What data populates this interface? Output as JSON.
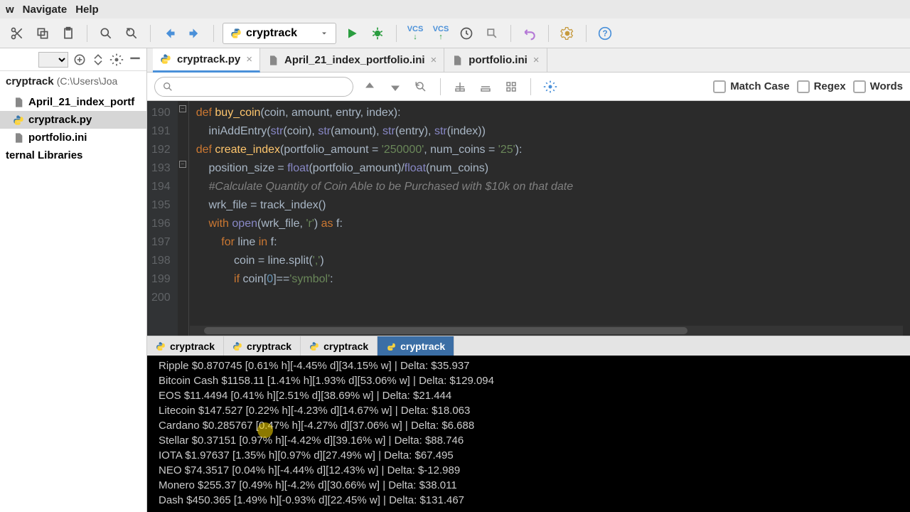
{
  "menu": {
    "items": [
      "w",
      "Navigate",
      "Help"
    ]
  },
  "toolbar": {
    "run_config_label": "cryptrack",
    "vcs_down": "VCS",
    "vcs_up": "VCS"
  },
  "project": {
    "root_name": "cryptrack",
    "root_path": "(C:\\Users\\Joa",
    "files": [
      "April_21_index_portf",
      "cryptrack.py",
      "portfolio.ini"
    ],
    "selected_index": 1,
    "ext_libs_label": "ternal Libraries"
  },
  "tabs": [
    {
      "label": "cryptrack.py",
      "active": true
    },
    {
      "label": "April_21_index_portfolio.ini",
      "active": false
    },
    {
      "label": "portfolio.ini",
      "active": false
    }
  ],
  "findbar": {
    "placeholder": "",
    "match_case": "Match Case",
    "regex": "Regex",
    "words": "Words"
  },
  "editor": {
    "first_line": 190,
    "lines": [
      190,
      191,
      192,
      193,
      194,
      195,
      196,
      197,
      198,
      199,
      200
    ],
    "code_lines": [
      {
        "t": "def",
        "tokens": [
          [
            "kw",
            "def "
          ],
          [
            "fn",
            "buy_coin"
          ],
          [
            "",
            "("
          ],
          [
            "",
            "coin, amount, entry, index"
          ],
          [
            "",
            "):"
          ]
        ]
      },
      {
        "indent": 4,
        "tokens": [
          [
            "",
            "iniAddEntry("
          ],
          [
            "bi",
            "str"
          ],
          [
            "",
            "("
          ],
          [
            "",
            "coin"
          ],
          [
            "",
            "), "
          ],
          [
            "bi",
            "str"
          ],
          [
            "",
            "("
          ],
          [
            "",
            "amount"
          ],
          [
            "",
            "), "
          ],
          [
            "bi",
            "str"
          ],
          [
            "",
            "("
          ],
          [
            "",
            "entry"
          ],
          [
            "",
            "), "
          ],
          [
            "bi",
            "str"
          ],
          [
            "",
            "("
          ],
          [
            "",
            "index"
          ],
          [
            "",
            ")) "
          ]
        ]
      },
      {
        "tokens": [
          [
            "",
            ""
          ]
        ]
      },
      {
        "t": "def",
        "tokens": [
          [
            "kw",
            "def "
          ],
          [
            "fn",
            "create_index"
          ],
          [
            "",
            "(portfolio_amount = "
          ],
          [
            "str",
            "'250000'"
          ],
          [
            "",
            ", num_coins = "
          ],
          [
            "str",
            "'25'"
          ],
          [
            "",
            "):"
          ]
        ]
      },
      {
        "indent": 4,
        "tokens": [
          [
            "",
            "position_size = "
          ],
          [
            "bi",
            "float"
          ],
          [
            "",
            "(portfolio_amount)/"
          ],
          [
            "bi",
            "float"
          ],
          [
            "",
            "(num_coins)"
          ]
        ]
      },
      {
        "indent": 4,
        "tokens": [
          [
            "cmt",
            "#Calculate Quantity of Coin Able to be Purchased with $10k on that date"
          ]
        ]
      },
      {
        "indent": 4,
        "tokens": [
          [
            "",
            "wrk_file = track_index()"
          ]
        ]
      },
      {
        "indent": 4,
        "tokens": [
          [
            "kw",
            "with "
          ],
          [
            "bi",
            "open"
          ],
          [
            "",
            "(wrk_file, "
          ],
          [
            "str",
            "'r'"
          ],
          [
            "",
            ") "
          ],
          [
            "kw",
            "as"
          ],
          [
            "",
            " f:"
          ]
        ]
      },
      {
        "indent": 8,
        "tokens": [
          [
            "kw",
            "for "
          ],
          [
            "",
            "line "
          ],
          [
            "kw",
            "in"
          ],
          [
            "",
            " f:"
          ]
        ]
      },
      {
        "indent": 12,
        "tokens": [
          [
            "",
            "coin = line.split("
          ],
          [
            "str",
            "','"
          ],
          [
            "",
            ")"
          ]
        ]
      },
      {
        "indent": 12,
        "tokens": [
          [
            "kw",
            "if "
          ],
          [
            "",
            "coin["
          ],
          [
            "num",
            "0"
          ],
          [
            "",
            "]=="
          ],
          [
            "str",
            "'symbol'"
          ],
          [
            "",
            ":"
          ]
        ]
      }
    ]
  },
  "run_tabs": [
    "cryptrack",
    "cryptrack",
    "cryptrack",
    "cryptrack"
  ],
  "run_tab_active": 3,
  "console_lines": [
    "Ripple $0.870745 [0.61% h][-4.45% d][34.15% w] | Delta: $35.937",
    "Bitcoin Cash $1158.11 [1.41% h][1.93% d][53.06% w] | Delta: $129.094",
    "EOS $11.4494 [0.41% h][2.51% d][38.69% w] | Delta: $21.444",
    "Litecoin $147.527 [0.22% h][-4.23% d][14.67% w] | Delta: $18.063",
    "Cardano $0.285767 [0.47% h][-4.27% d][37.06% w] | Delta: $6.688",
    "Stellar $0.37151 [0.97% h][-4.42% d][39.16% w] | Delta: $88.746",
    "IOTA $1.97637 [1.35% h][0.97% d][27.49% w] | Delta: $67.495",
    "NEO $74.3517 [0.04% h][-4.44% d][12.43% w] | Delta: $-12.989",
    "Monero $255.37 [0.49% h][-4.2% d][30.66% w] | Delta: $38.011",
    "Dash $450.365 [1.49% h][-0.93% d][22.45% w] | Delta: $131.467"
  ]
}
